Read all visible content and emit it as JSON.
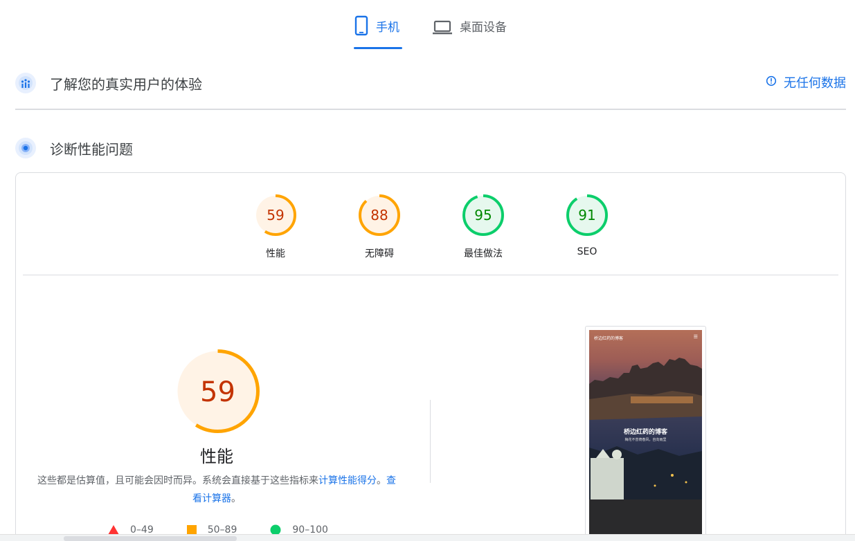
{
  "tabs": [
    {
      "label": "手机",
      "icon": "smartphone-icon",
      "active": true
    },
    {
      "label": "桌面设备",
      "icon": "laptop-icon",
      "active": false
    }
  ],
  "real_user": {
    "title": "了解您的真实用户的体验",
    "no_data": "无任何数据"
  },
  "diagnose": {
    "title": "诊断性能问题"
  },
  "scores": [
    {
      "value": 59,
      "label": "性能",
      "color": "#ffa400",
      "text_color": "#c33300",
      "fill": "#fff3e6"
    },
    {
      "value": 88,
      "label": "无障碍",
      "color": "#ffa400",
      "text_color": "#c33300",
      "fill": "#fff3e6"
    },
    {
      "value": 95,
      "label": "最佳做法",
      "color": "#0cce6b",
      "text_color": "#008800",
      "fill": "#e6f8ee"
    },
    {
      "value": 91,
      "label": "SEO",
      "color": "#0cce6b",
      "text_color": "#008800",
      "fill": "#e6f8ee"
    }
  ],
  "main_score": {
    "value": 59,
    "title": "性能"
  },
  "description": {
    "text": "这些都是估算值，且可能会因时而异。系统会直接基于这些指标来",
    "link1": "计算性能得分",
    "sep": "。",
    "link2": "查看计算器",
    "end": "。"
  },
  "legend": [
    {
      "shape": "triangle",
      "label": "0–49",
      "color": "#ff3333"
    },
    {
      "shape": "square",
      "label": "50–89",
      "color": "#ffa400"
    },
    {
      "shape": "circle",
      "label": "90–100",
      "color": "#0cce6b"
    }
  ],
  "screenshot": {
    "header": "桥边红药的博客",
    "title": "桥边红药的博客",
    "subtitle": "梅花不曾倚春风，自向雨里"
  }
}
